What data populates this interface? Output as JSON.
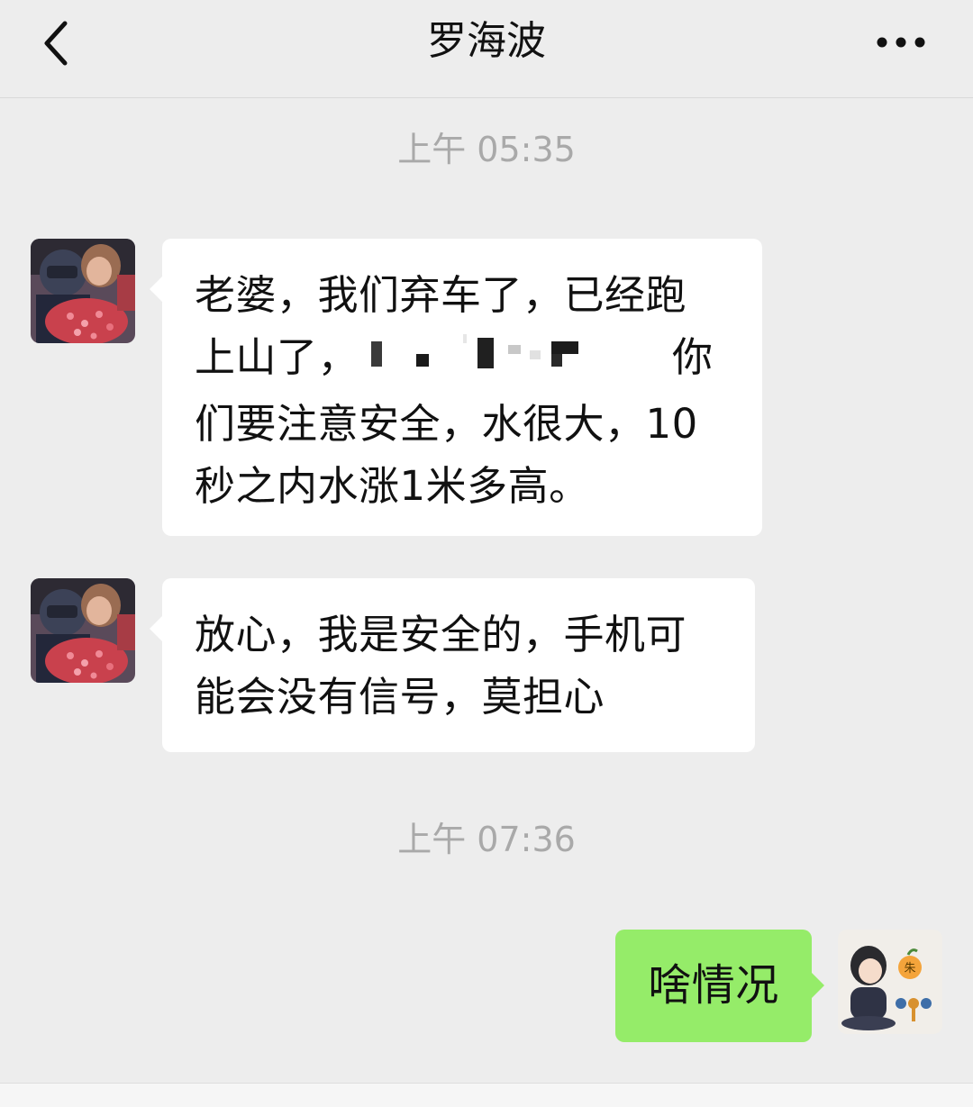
{
  "header": {
    "title": "罗海波",
    "back_icon": "chevron-left-icon",
    "more_icon": "more-dots-icon"
  },
  "messages": [
    {
      "type": "timestamp",
      "text": "上午 05:35"
    },
    {
      "type": "incoming",
      "lines": [
        "老婆，我们弃车了，已经跑",
        "上山了，",
        "你",
        "们要注意安全，水很大，10",
        "秒之内水涨1米多高。"
      ]
    },
    {
      "type": "incoming",
      "lines": [
        "放心，我是安全的，手机可",
        "能会没有信号，莫担心"
      ]
    },
    {
      "type": "timestamp",
      "text": "上午 07:36"
    },
    {
      "type": "outgoing",
      "text": "啥情况"
    }
  ],
  "sticker_text": "朱",
  "colors": {
    "background": "#ededed",
    "incoming_bubble": "#ffffff",
    "outgoing_bubble": "#95ec69",
    "timestamp": "#a9a9a9"
  }
}
